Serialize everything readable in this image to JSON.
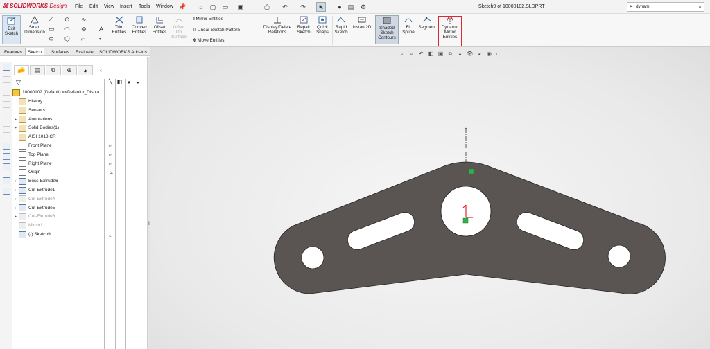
{
  "app": {
    "logo_text": "SOLIDWORKS",
    "logo_suffix": "Design",
    "window_title": "Sketch9 of 10000102.SLDPRT"
  },
  "menu": [
    "File",
    "Edit",
    "View",
    "Insert",
    "Tools",
    "Window"
  ],
  "search": {
    "prompt": ">",
    "value": "dynam"
  },
  "ribbon": {
    "exit_sketch": "Exit\nSketch",
    "smart_dimension": "Smart\nDimension",
    "trim": "Trim\nEntities",
    "convert": "Convert\nEntities",
    "offset": "Offset\nEntities",
    "offset_surface": "Offset\nOn\nSurface",
    "mirror_entities": "Mirror Entities",
    "linear_pattern": "Linear Sketch Pattern",
    "move_entities": "Move Entities",
    "display_delete": "Display/Delete\nRelations",
    "repair": "Repair\nSketch",
    "quick_snaps": "Quick\nSnaps",
    "rapid_sketch": "Rapid\nSketch",
    "instant2d": "Instant2D",
    "shaded_contours": "Shaded\nSketch\nContours",
    "fit_spline": "Fit\nSpline",
    "segment": "Segment",
    "dynamic_mirror": "Dynamic\nMirror\nEntities"
  },
  "command_tabs": [
    "Features",
    "Sketch",
    "Surfaces",
    "Evaluate",
    "SOLIDWORKS Add-Ins"
  ],
  "active_tab": "Sketch",
  "feature_tree": {
    "root": "10000102 (Default) <<Default>_Displa",
    "items": [
      {
        "label": "History",
        "dim": false,
        "arrow": ""
      },
      {
        "label": "Sensors",
        "dim": false,
        "arrow": ""
      },
      {
        "label": "Annotations",
        "dim": false,
        "arrow": "▸"
      },
      {
        "label": "Solid Bodies(1)",
        "dim": false,
        "arrow": "▸"
      },
      {
        "label": "AISI 1018 CR",
        "dim": false,
        "arrow": ""
      },
      {
        "label": "Front Plane",
        "dim": false,
        "arrow": ""
      },
      {
        "label": "Top Plane",
        "dim": false,
        "arrow": ""
      },
      {
        "label": "Right Plane",
        "dim": false,
        "arrow": ""
      },
      {
        "label": "Origin",
        "dim": false,
        "arrow": ""
      },
      {
        "label": "Boss-Extrude6",
        "dim": false,
        "arrow": "▸"
      },
      {
        "label": "Cut-Extrude1",
        "dim": false,
        "arrow": "▸"
      },
      {
        "label": "Cut-Extrude4",
        "dim": true,
        "arrow": "▸"
      },
      {
        "label": "Cut-Extrude5",
        "dim": false,
        "arrow": "▸"
      },
      {
        "label": "Cut-Extrude6",
        "dim": true,
        "arrow": "▸"
      },
      {
        "label": "Mirror1",
        "dim": true,
        "arrow": ""
      },
      {
        "label": "(-) Sketch9",
        "dim": false,
        "arrow": ""
      }
    ]
  },
  "colors": {
    "part_fill": "#5a5553",
    "hole_fill": "#ffffff",
    "highlight": "#e0262e",
    "accent": "#9eb6cf"
  }
}
